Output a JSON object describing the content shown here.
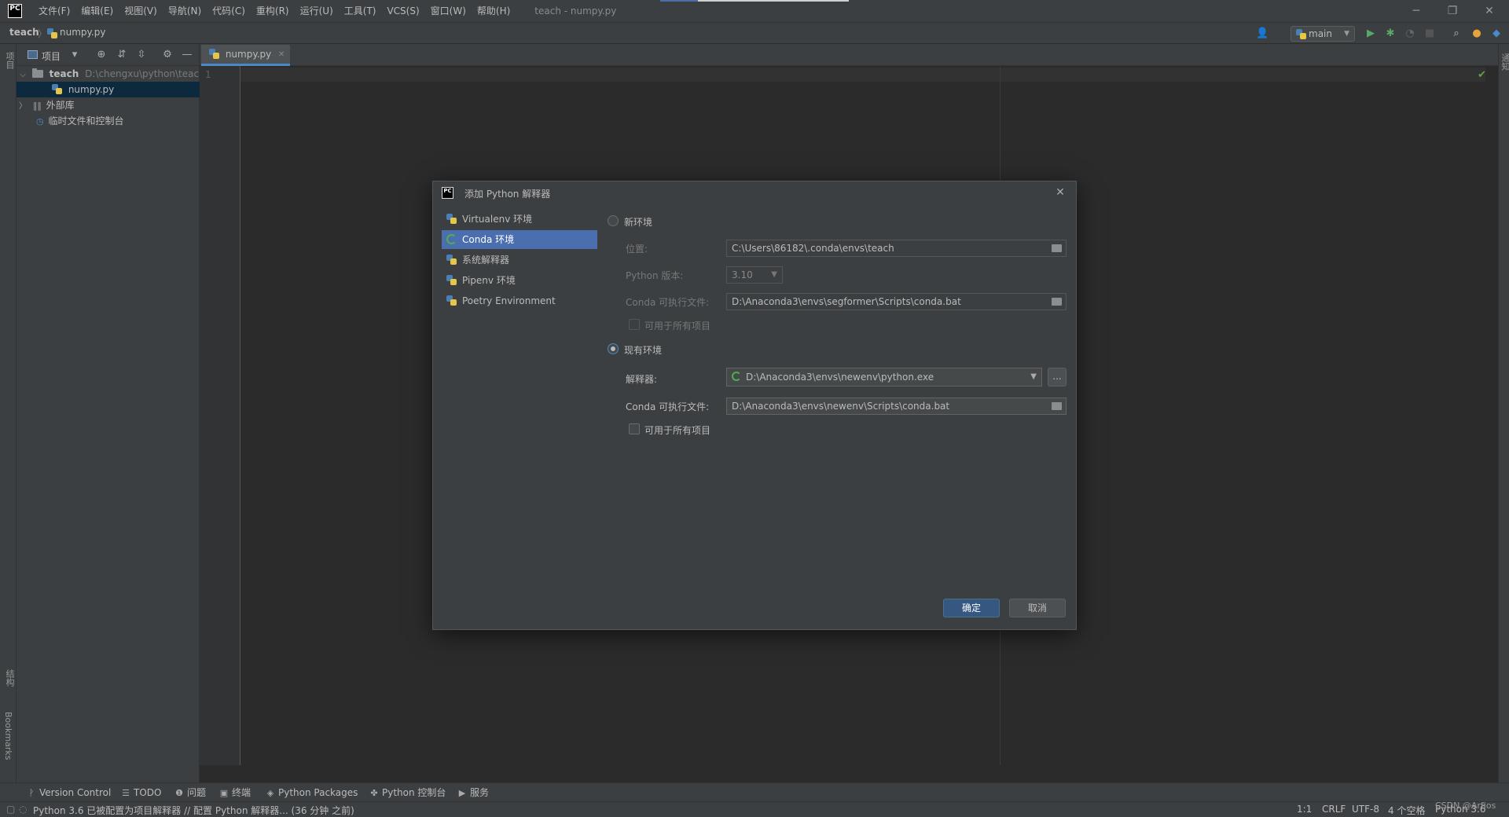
{
  "menubar": {
    "logo_text": "PC",
    "items": [
      "文件(F)",
      "编辑(E)",
      "视图(V)",
      "导航(N)",
      "代码(C)",
      "重构(R)",
      "运行(U)",
      "工具(T)",
      "VCS(S)",
      "窗口(W)",
      "帮助(H)"
    ],
    "window_title": "teach - numpy.py",
    "controls": {
      "minimize": "─",
      "restore": "❐",
      "close": "✕"
    }
  },
  "navbar": {
    "project": "teach",
    "separator": "〉",
    "file": "numpy.py",
    "branch": "main",
    "branch_caret": "▼",
    "icons": {
      "user": "👤",
      "run": "▶",
      "debug": "✱",
      "coverage": "◔",
      "stop": "■",
      "search": "⌕",
      "update": "●",
      "plugin": "◆"
    }
  },
  "left_strip": {
    "top_label": "项目",
    "structure_label": "结构",
    "bookmarks_label": "Bookmarks"
  },
  "right_strip": {
    "notifications_label": "通知"
  },
  "project_panel": {
    "view_label": "项目",
    "dropdown": "▾",
    "toolbar_icons": {
      "locate": "⊕",
      "expand": "⇵",
      "collapse": "⇳",
      "settings": "⚙",
      "hide": "—"
    },
    "tree": [
      {
        "caret": "⌵",
        "label": "teach",
        "path": "D:\\chengxu\\python\\teach"
      },
      {
        "caret": "",
        "label": "numpy.py",
        "path": ""
      },
      {
        "caret": "〉",
        "label": "外部库",
        "path": ""
      },
      {
        "caret": "",
        "label": "临时文件和控制台",
        "path": ""
      }
    ]
  },
  "editor": {
    "tab": "numpy.py",
    "tab_close": "✕",
    "line_numbers": [
      "1"
    ],
    "check": "✔"
  },
  "dialog": {
    "logo_text": "PC",
    "title": "添加 Python 解释器",
    "close": "✕",
    "env_types": [
      "Virtualenv 环境",
      "Conda 环境",
      "系统解释器",
      "Pipenv 环境",
      "Poetry Environment"
    ],
    "selected_env": "Conda 环境",
    "new_env": {
      "radio_label": "新环境",
      "location_label": "位置:",
      "location_value": "C:\\Users\\86182\\.conda\\envs\\teach",
      "python_version_label": "Python 版本:",
      "python_version_value": "3.10",
      "conda_exec_label": "Conda 可执行文件:",
      "conda_exec_value": "D:\\Anaconda3\\envs\\segformer\\Scripts\\conda.bat",
      "make_available_label": "可用于所有项目"
    },
    "existing_env": {
      "radio_label": "现有环境",
      "interpreter_label": "解释器:",
      "interpreter_value": "D:\\Anaconda3\\envs\\newenv\\python.exe",
      "browse_label": "...",
      "conda_exec_label": "Conda 可执行文件:",
      "conda_exec_value": "D:\\Anaconda3\\envs\\newenv\\Scripts\\conda.bat",
      "make_available_label": "可用于所有项目"
    },
    "ok_label": "确定",
    "cancel_label": "取消"
  },
  "tool_tabs": [
    {
      "icon": "ᚹ",
      "label": "Version Control"
    },
    {
      "icon": "☰",
      "label": "TODO"
    },
    {
      "icon": "❶",
      "label": "问题"
    },
    {
      "icon": "▣",
      "label": "终端"
    },
    {
      "icon": "◈",
      "label": "Python Packages"
    },
    {
      "icon": "✤",
      "label": "Python 控制台"
    },
    {
      "icon": "▶",
      "label": "服务"
    }
  ],
  "status_bar": {
    "message": "Python 3.6 已被配置为项目解释器 // 配置 Python 解释器... (36 分钟 之前)",
    "position": "1:1",
    "line_separator": "CRLF",
    "encoding": "UTF-8",
    "indent": "4 个空格",
    "interpreter": "Python 3.6",
    "watermark": "CSDN @Arfios"
  },
  "colors": {
    "accent": "#4b6eaf",
    "primary_button": "#365880",
    "conda_green": "#4fae4f",
    "background": "#2b2b2b",
    "panel": "#3c3f41"
  }
}
